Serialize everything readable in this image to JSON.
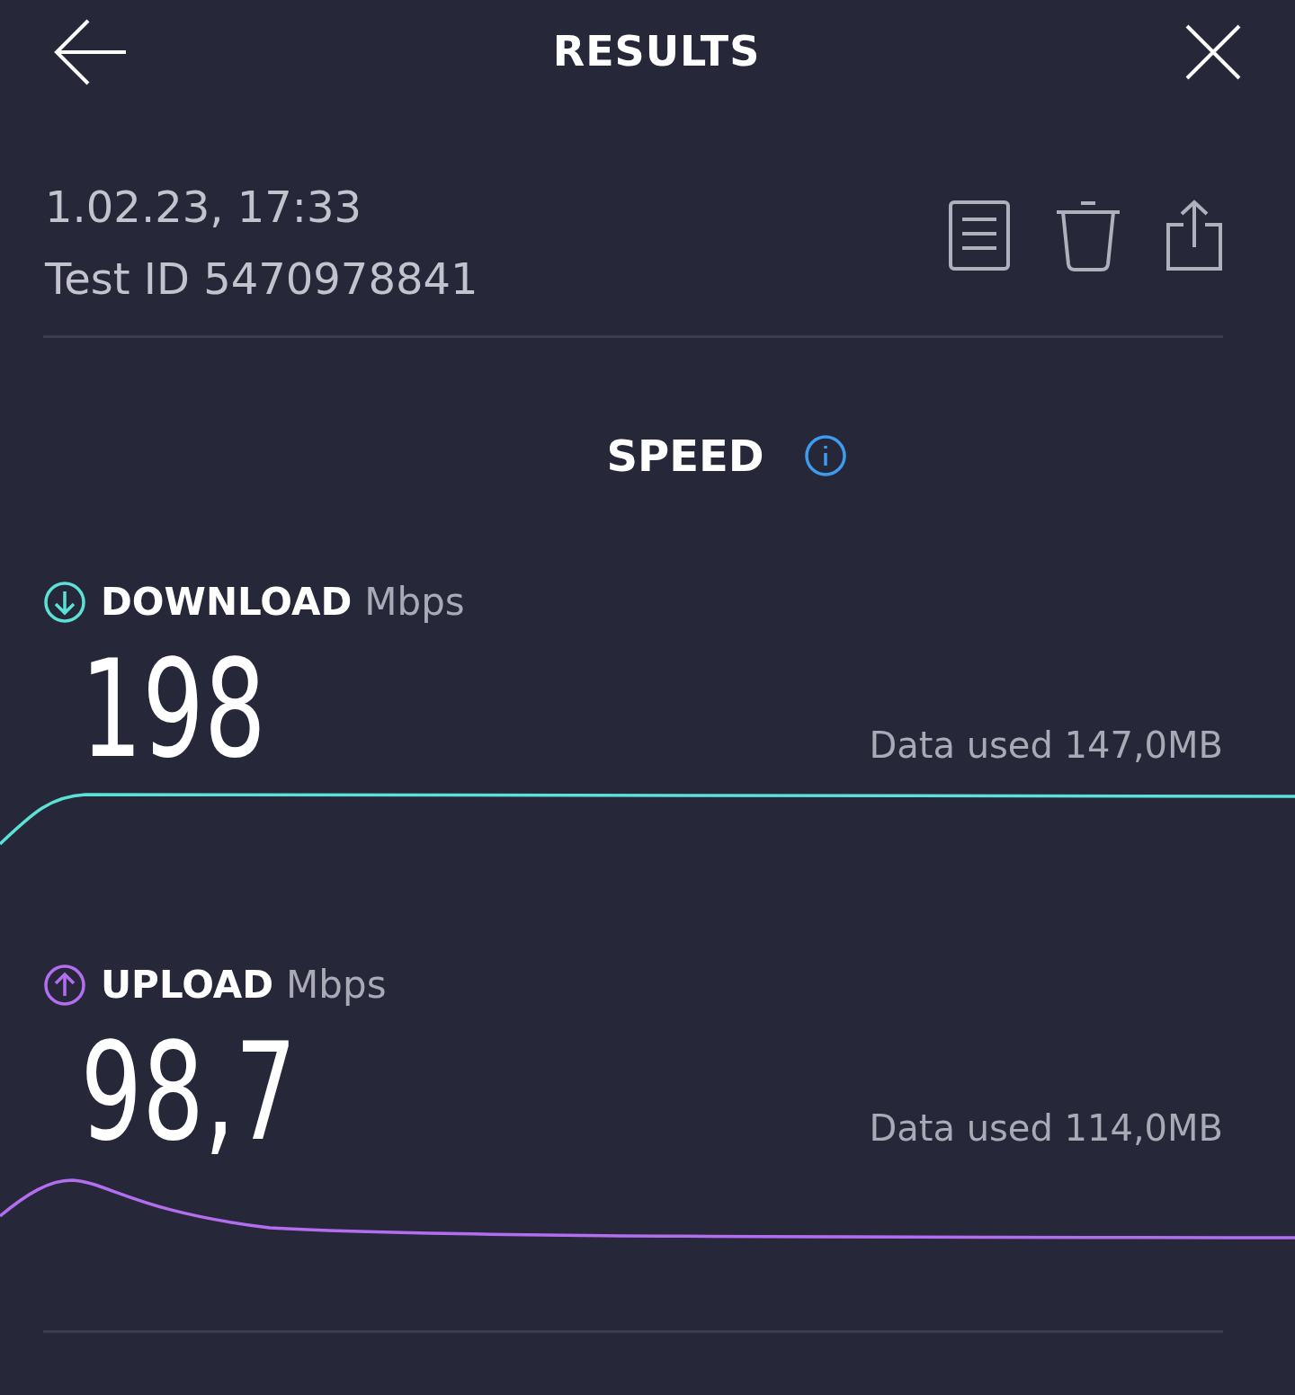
{
  "header": {
    "title": "RESULTS"
  },
  "test": {
    "date": "1.02.23, 17:33",
    "test_id": "Test ID 5470978841"
  },
  "section": {
    "title": "SPEED"
  },
  "metrics": [
    {
      "kind": "download",
      "label": "DOWNLOAD",
      "unit": "Mbps",
      "value": "198",
      "data_used": "Data used 147,0MB",
      "color": "#5ce1d6"
    },
    {
      "kind": "upload",
      "label": "UPLOAD",
      "unit": "Mbps",
      "value": "98,7",
      "data_used": "Data used 114,0MB",
      "color": "#b36ef0"
    }
  ]
}
